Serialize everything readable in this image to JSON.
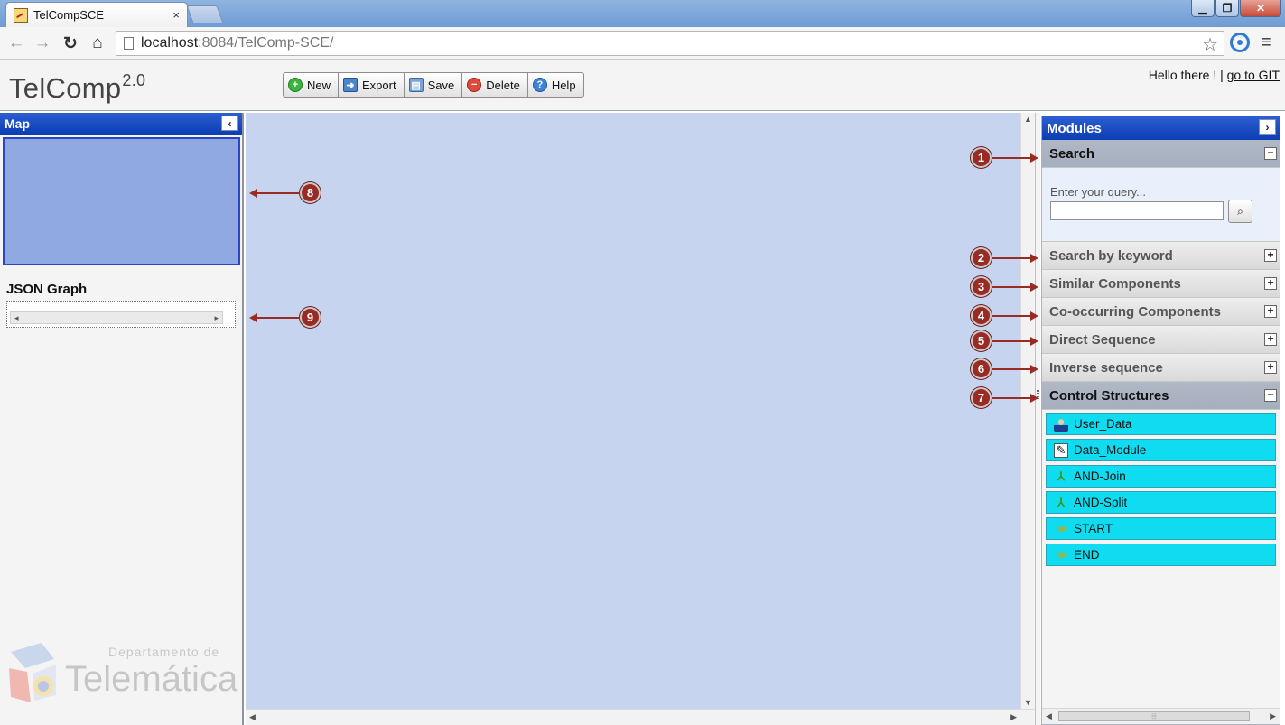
{
  "browser": {
    "tab_title": "TelCompSCE",
    "tab_close": "×",
    "url_host": "localhost",
    "url_rest": ":8084/TelComp-SCE/",
    "back_icon": "back-arrow-icon",
    "forward_icon": "forward-arrow-icon",
    "reload_icon": "reload-icon",
    "home_icon": "home-icon"
  },
  "app": {
    "title": "TelComp",
    "version": "2.0",
    "greeting": "Hello there ! |",
    "git_link": "go to GIT"
  },
  "toolbar": {
    "new_label": "New",
    "export_label": "Export",
    "save_label": "Save",
    "delete_label": "Delete",
    "help_label": "Help"
  },
  "left_panel": {
    "map_title": "Map",
    "json_graph_title": "JSON Graph",
    "logo_small": "Departamento de",
    "logo_big": "Telemática"
  },
  "modules": {
    "title": "Modules",
    "search": {
      "title": "Search",
      "query_label": "Enter your query...",
      "query_value": ""
    },
    "search_by_keyword": "Search by keyword",
    "similar_components": "Similar Components",
    "co_occurring_components": "Co-occurring Components",
    "direct_sequence": "Direct Sequence",
    "inverse_sequence": "Inverse sequence",
    "control_structures": {
      "title": "Control Structures",
      "items": [
        {
          "label": "User_Data",
          "icon": "user-icon"
        },
        {
          "label": "Data_Module",
          "icon": "data-module-icon"
        },
        {
          "label": "AND-Join",
          "icon": "and-join-icon"
        },
        {
          "label": "AND-Split",
          "icon": "and-split-icon"
        },
        {
          "label": "START",
          "icon": "start-arrow-icon"
        },
        {
          "label": "END",
          "icon": "end-arrow-icon"
        }
      ]
    }
  },
  "annotations": [
    "1",
    "2",
    "3",
    "4",
    "5",
    "6",
    "7",
    "8",
    "9"
  ],
  "colors": {
    "panel_header": "#0b3eb3",
    "canvas": "#c6d4ef",
    "map": "#90a9e2",
    "control_item": "#0fdcf0",
    "annotation": "#9a2a24"
  }
}
